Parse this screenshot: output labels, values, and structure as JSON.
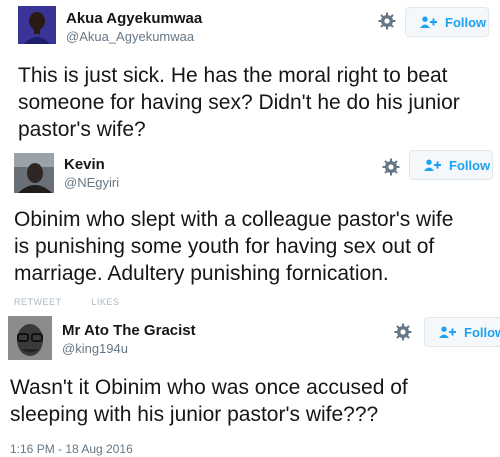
{
  "tweets": [
    {
      "name": "Akua Agyekumwaa",
      "handle": "@Akua_Agyekumwaa",
      "follow_label": "Follow",
      "lines": [
        "This is just sick. He has the moral right to beat",
        "someone for having sex? Didn't he do his junior",
        "pastor's wife?"
      ]
    },
    {
      "name": "Kevin",
      "handle": "@NEgyiri",
      "follow_label": "Follow",
      "lines": [
        "Obinim who slept with a colleague pastor's wife",
        "is punishing some youth for having sex out of",
        "marriage.  Adultery punishing fornication."
      ],
      "faded_stats": "RETWEET          LIKES"
    },
    {
      "name": "Mr Ato The Gracist",
      "handle": "@king194u",
      "follow_label": "Follow",
      "lines": [
        "Wasn't it Obinim who was once accused of",
        "sleeping with his junior pastor's wife???"
      ],
      "timestamp": "1:16 PM - 18 Aug 2016"
    }
  ],
  "colors": {
    "accent": "#1da1f2",
    "secondary_text": "#657786",
    "button_bg": "#f5f8fa",
    "button_border": "#e1e8ed"
  },
  "icons": [
    "settings-gear-icon",
    "follow-person-plus-icon"
  ]
}
